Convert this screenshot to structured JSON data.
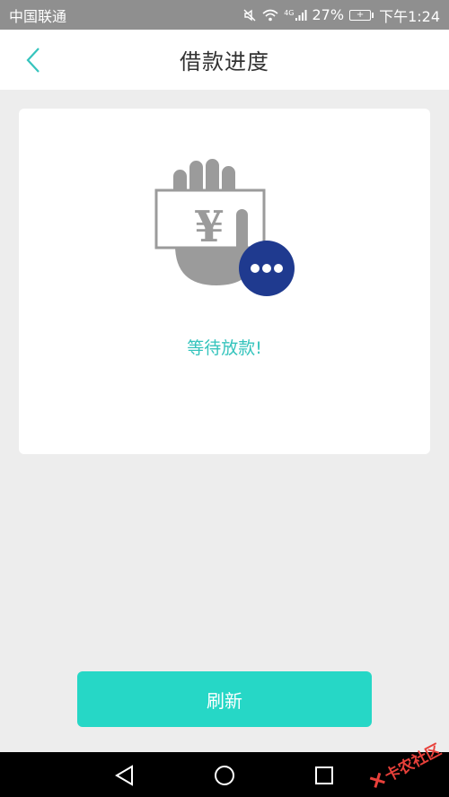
{
  "status_bar": {
    "carrier": "中国联通",
    "network_label": "4G",
    "battery_percent": "27%",
    "time": "下午1:24"
  },
  "header": {
    "title": "借款进度",
    "back_icon": "chevron-left-icon"
  },
  "card": {
    "illustration_symbol": "¥",
    "illustration_icon": "hand-money-waiting-icon",
    "status_text": "等待放款!"
  },
  "actions": {
    "refresh_label": "刷新"
  },
  "watermark": {
    "text": "卡农社区"
  },
  "colors": {
    "accent": "#35c4bd",
    "button": "#26d7c6",
    "badge": "#1f3a8f",
    "illustration_gray": "#9b9b9b",
    "status_bar": "#8f8f8f"
  }
}
